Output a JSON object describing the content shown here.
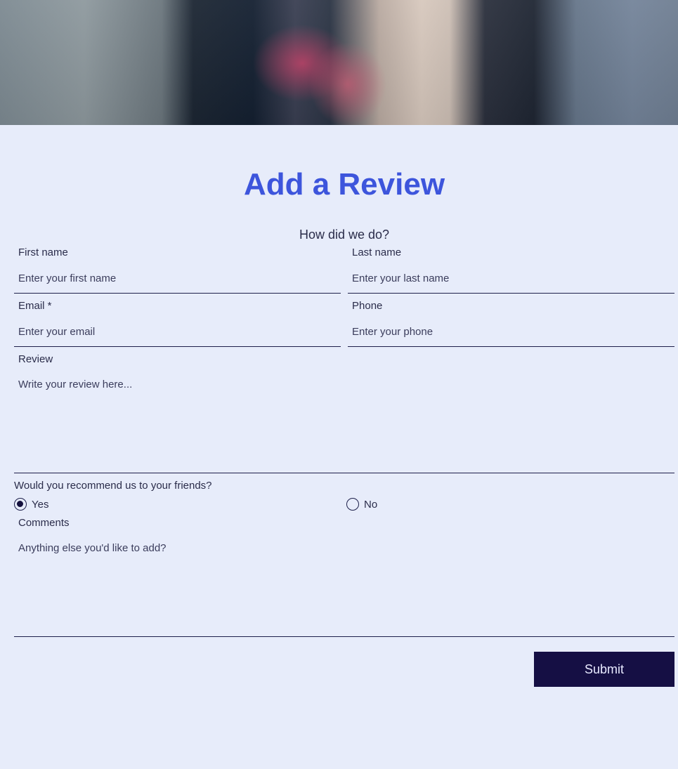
{
  "hero": {
    "image": "blurred-people-photo"
  },
  "form": {
    "title": "Add a Review",
    "subtitle": "How did we do?",
    "first_name": {
      "label": "First name",
      "placeholder": "Enter your first name"
    },
    "last_name": {
      "label": "Last name",
      "placeholder": "Enter your last name"
    },
    "email": {
      "label": "Email *",
      "placeholder": "Enter your email"
    },
    "phone": {
      "label": "Phone",
      "placeholder": "Enter your phone"
    },
    "review": {
      "label": "Review",
      "placeholder": "Write your review here..."
    },
    "recommend": {
      "question": "Would you recommend us to your friends?",
      "options": [
        {
          "label": "Yes",
          "selected": true
        },
        {
          "label": "No",
          "selected": false
        }
      ]
    },
    "comments": {
      "label": "Comments",
      "placeholder": "Anything else you'd like to add?"
    },
    "submit_label": "Submit"
  },
  "colors": {
    "background": "#e7ecfa",
    "title": "#3d55dc",
    "button": "#150f44"
  }
}
